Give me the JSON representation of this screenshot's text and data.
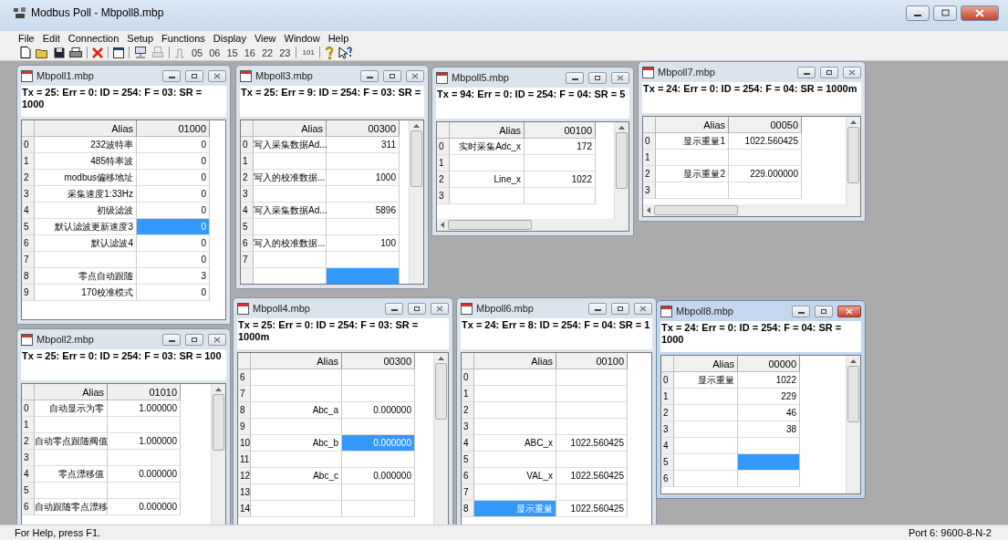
{
  "window": {
    "title": "Modbus Poll - Mbpoll8.mbp"
  },
  "menu": [
    "File",
    "Edit",
    "Connection",
    "Setup",
    "Functions",
    "Display",
    "View",
    "Window",
    "Help"
  ],
  "toolbar": {
    "function_codes": [
      "05",
      "06",
      "15",
      "16",
      "22",
      "23"
    ],
    "test_center": "101"
  },
  "documents": [
    {
      "title": "Mbpoll1.mbp",
      "active": false,
      "status": "Tx = 25: Err = 0: ID = 254: F = 03: SR = 1000",
      "columns": [
        "Alias",
        "01000"
      ],
      "rows": [
        {
          "index": "0",
          "cells": [
            {
              "text": "232波特率",
              "selected": false
            },
            {
              "text": "0",
              "selected": false
            }
          ]
        },
        {
          "index": "1",
          "cells": [
            {
              "text": "485特率波",
              "selected": false
            },
            {
              "text": "0",
              "selected": false
            }
          ]
        },
        {
          "index": "2",
          "cells": [
            {
              "text": "modbus偏移地址",
              "selected": false
            },
            {
              "text": "0",
              "selected": false
            }
          ]
        },
        {
          "index": "3",
          "cells": [
            {
              "text": "采集速度1:33Hz",
              "selected": false
            },
            {
              "text": "0",
              "selected": false
            }
          ]
        },
        {
          "index": "4",
          "cells": [
            {
              "text": "初级滤波",
              "selected": false
            },
            {
              "text": "0",
              "selected": false
            }
          ]
        },
        {
          "index": "5",
          "cells": [
            {
              "text": "默认滤波更新速度3",
              "selected": false
            },
            {
              "text": "0",
              "selected": true
            }
          ]
        },
        {
          "index": "6",
          "cells": [
            {
              "text": "默认滤波4",
              "selected": false
            },
            {
              "text": "0",
              "selected": false
            }
          ]
        },
        {
          "index": "7",
          "cells": [
            {
              "selected": false
            },
            {
              "text": "0",
              "selected": false
            }
          ]
        },
        {
          "index": "8",
          "cells": [
            {
              "text": "零点自动跟随",
              "selected": false
            },
            {
              "text": "3",
              "selected": false
            }
          ]
        },
        {
          "index": "9",
          "cells": [
            {
              "text": "170校准模式",
              "selected": false
            },
            {
              "text": "0",
              "selected": false
            }
          ]
        }
      ]
    },
    {
      "title": "Mbpoll3.mbp",
      "active": false,
      "status": "Tx = 25: Err = 9: ID = 254: F = 03: SR =",
      "columns": [
        "Alias",
        "00300"
      ],
      "rows": [
        {
          "index": "0",
          "cells": [
            {
              "text": "写入采集数据Ad...",
              "selected": false
            },
            {
              "text": "311",
              "selected": false
            }
          ]
        },
        {
          "index": "1",
          "cells": [
            {
              "selected": false
            },
            {
              "selected": false
            }
          ]
        },
        {
          "index": "2",
          "cells": [
            {
              "text": "写入的校准数据...",
              "selected": false
            },
            {
              "text": "1000",
              "selected": false
            }
          ]
        },
        {
          "index": "3",
          "cells": [
            {
              "selected": false
            },
            {
              "selected": false
            }
          ]
        },
        {
          "index": "4",
          "cells": [
            {
              "text": "写入采集数据Ad...",
              "selected": false
            },
            {
              "text": "5896",
              "selected": false
            }
          ]
        },
        {
          "index": "5",
          "cells": [
            {
              "selected": false
            },
            {
              "selected": false
            }
          ]
        },
        {
          "index": "6",
          "cells": [
            {
              "text": "写入的校准数据...",
              "selected": false
            },
            {
              "text": "100",
              "selected": false
            }
          ]
        },
        {
          "index": "7",
          "cells": [
            {
              "selected": false
            },
            {
              "selected": false
            }
          ]
        },
        {
          "cells": [
            {
              "selected": false
            },
            {
              "selected": true
            }
          ]
        }
      ]
    },
    {
      "title": "Mbpoll5.mbp",
      "active": false,
      "status": "Tx = 94: Err = 0: ID = 254: F = 04: SR = 5",
      "columns": [
        "Alias",
        "00100"
      ],
      "rows": [
        {
          "index": "0",
          "cells": [
            {
              "text": "实时采集Adc_x",
              "selected": false
            },
            {
              "text": "172",
              "selected": false
            }
          ]
        },
        {
          "index": "1",
          "cells": [
            {
              "selected": false
            },
            {
              "selected": false
            }
          ]
        },
        {
          "index": "2",
          "cells": [
            {
              "text": "Line_x",
              "selected": false
            },
            {
              "text": "1022",
              "selected": false
            }
          ]
        },
        {
          "index": "3",
          "cells": [
            {
              "selected": false
            },
            {
              "selected": false
            }
          ]
        }
      ]
    },
    {
      "title": "Mbpoll7.mbp",
      "active": false,
      "status": "Tx = 24: Err = 0: ID = 254: F = 04: SR = 1000m",
      "columns": [
        "Alias",
        "00050"
      ],
      "rows": [
        {
          "index": "0",
          "cells": [
            {
              "text": "显示重量1",
              "selected": false
            },
            {
              "text": "1022.560425",
              "selected": false
            }
          ]
        },
        {
          "index": "1",
          "cells": [
            {
              "selected": false
            },
            {
              "selected": false
            }
          ]
        },
        {
          "index": "2",
          "cells": [
            {
              "text": "显示重量2",
              "selected": false
            },
            {
              "text": "229.000000",
              "selected": false
            }
          ]
        },
        {
          "index": "3",
          "cells": [
            {
              "selected": false
            },
            {
              "selected": false
            }
          ]
        }
      ]
    },
    {
      "title": "Mbpoll2.mbp",
      "active": false,
      "status": "Tx = 25: Err = 0: ID = 254: F = 03: SR = 100",
      "columns": [
        "Alias",
        "01010"
      ],
      "rows": [
        {
          "index": "0",
          "cells": [
            {
              "text": "自动显示为零",
              "selected": false
            },
            {
              "text": "1.000000",
              "selected": false
            }
          ]
        },
        {
          "index": "1",
          "cells": [
            {
              "selected": false
            },
            {
              "selected": false
            }
          ]
        },
        {
          "index": "2",
          "cells": [
            {
              "text": "自动零点跟随阀值",
              "selected": false
            },
            {
              "text": "1.000000",
              "selected": false
            }
          ]
        },
        {
          "index": "3",
          "cells": [
            {
              "selected": false
            },
            {
              "selected": false
            }
          ]
        },
        {
          "index": "4",
          "cells": [
            {
              "text": "零点漂移值",
              "selected": false
            },
            {
              "text": "0.000000",
              "selected": false
            }
          ]
        },
        {
          "index": "5",
          "cells": [
            {
              "selected": false
            },
            {
              "selected": false
            }
          ]
        },
        {
          "index": "6",
          "cells": [
            {
              "text": "自动跟随零点漂移",
              "selected": false
            },
            {
              "text": "0.000000",
              "selected": false
            }
          ]
        }
      ]
    },
    {
      "title": "Mbpoll4.mbp",
      "active": false,
      "status": "Tx = 25: Err = 0: ID = 254: F = 03: SR = 1000m",
      "columns": [
        "Alias",
        "00300"
      ],
      "rows": [
        {
          "index": "6",
          "cells": [
            {
              "selected": false
            },
            {
              "selected": false
            }
          ]
        },
        {
          "index": "7",
          "cells": [
            {
              "selected": false
            },
            {
              "selected": false
            }
          ]
        },
        {
          "index": "8",
          "cells": [
            {
              "text": "Abc_a",
              "selected": false
            },
            {
              "text": "0.000000",
              "selected": false
            }
          ]
        },
        {
          "index": "9",
          "cells": [
            {
              "selected": false
            },
            {
              "selected": false
            }
          ]
        },
        {
          "index": "10",
          "cells": [
            {
              "text": "Abc_b",
              "selected": false
            },
            {
              "text": "0.000000",
              "selected": true
            }
          ]
        },
        {
          "index": "11",
          "cells": [
            {
              "selected": false
            },
            {
              "selected": false
            }
          ]
        },
        {
          "index": "12",
          "cells": [
            {
              "text": "Abc_c",
              "selected": false
            },
            {
              "text": "0.000000",
              "selected": false
            }
          ]
        },
        {
          "index": "13",
          "cells": [
            {
              "selected": false
            },
            {
              "selected": false
            }
          ]
        },
        {
          "index": "14",
          "cells": [
            {
              "selected": false
            },
            {
              "selected": false
            }
          ]
        }
      ]
    },
    {
      "title": "Mbpoll6.mbp",
      "active": false,
      "status": "Tx = 24: Err = 8: ID = 254: F = 04: SR = 1",
      "columns": [
        "Alias",
        "00100"
      ],
      "rows": [
        {
          "index": "0",
          "cells": [
            {
              "selected": false
            },
            {
              "selected": false
            }
          ]
        },
        {
          "index": "1",
          "cells": [
            {
              "selected": false
            },
            {
              "selected": false
            }
          ]
        },
        {
          "index": "2",
          "cells": [
            {
              "selected": false
            },
            {
              "selected": false
            }
          ]
        },
        {
          "index": "3",
          "cells": [
            {
              "selected": false
            },
            {
              "selected": false
            }
          ]
        },
        {
          "index": "4",
          "cells": [
            {
              "text": "ABC_x",
              "selected": false
            },
            {
              "text": "1022.560425",
              "selected": false
            }
          ]
        },
        {
          "index": "5",
          "cells": [
            {
              "selected": false
            },
            {
              "selected": false
            }
          ]
        },
        {
          "index": "6",
          "cells": [
            {
              "text": "VAL_x",
              "selected": false
            },
            {
              "text": "1022.560425",
              "selected": false
            }
          ]
        },
        {
          "index": "7",
          "cells": [
            {
              "selected": false
            },
            {
              "selected": false
            }
          ]
        },
        {
          "index": "8",
          "cells": [
            {
              "text": "显示重量",
              "selected": true
            },
            {
              "text": "1022.560425",
              "selected": false
            }
          ]
        }
      ]
    },
    {
      "title": "Mbpoll8.mbp",
      "active": true,
      "status": "Tx = 24: Err = 0: ID = 254: F = 04: SR = 1000",
      "columns": [
        "Alias",
        "00000"
      ],
      "rows": [
        {
          "index": "0",
          "cells": [
            {
              "text": "显示重量",
              "selected": false
            },
            {
              "text": "1022",
              "selected": false
            }
          ]
        },
        {
          "index": "1",
          "cells": [
            {
              "selected": false
            },
            {
              "text": "229",
              "selected": false
            }
          ]
        },
        {
          "index": "2",
          "cells": [
            {
              "selected": false
            },
            {
              "text": "46",
              "selected": false
            }
          ]
        },
        {
          "index": "3",
          "cells": [
            {
              "selected": false
            },
            {
              "text": "38",
              "selected": false
            }
          ]
        },
        {
          "index": "4",
          "cells": [
            {
              "selected": false
            },
            {
              "selected": false
            }
          ]
        },
        {
          "index": "5",
          "cells": [
            {
              "selected": false
            },
            {
              "selected": true
            }
          ]
        },
        {
          "index": "6",
          "cells": [
            {
              "selected": false
            },
            {
              "selected": false
            }
          ]
        }
      ]
    }
  ],
  "status_bar": {
    "help": "For Help, press F1.",
    "port": "Port 6: 9600-8-N-2"
  }
}
